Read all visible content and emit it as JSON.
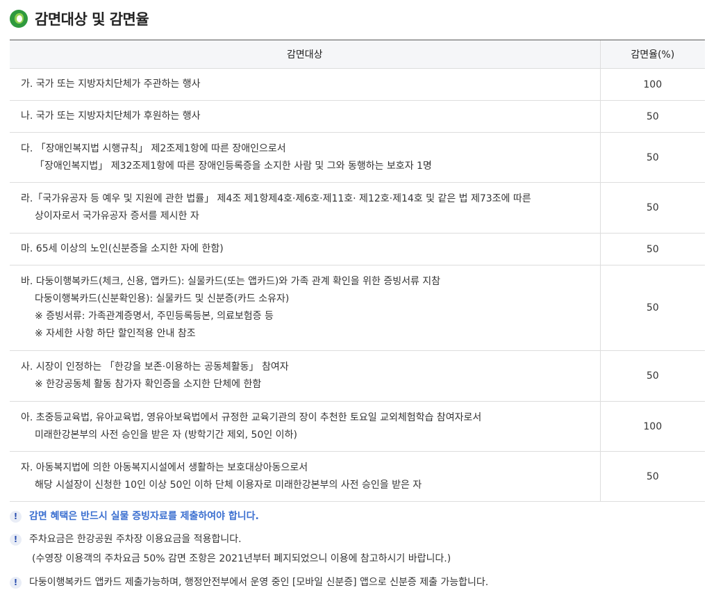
{
  "page_title": "감면대상 및 감면율",
  "table": {
    "headers": {
      "target": "감면대상",
      "rate": "감면율(%)"
    },
    "rows": [
      {
        "lines": [
          "가. 국가 또는 지방자치단체가 주관하는 행사"
        ],
        "rate": "100"
      },
      {
        "lines": [
          "나. 국가 또는 지방자치단체가 후원하는 행사"
        ],
        "rate": "50"
      },
      {
        "lines": [
          "다. 「장애인복지법 시행규칙」 제2조제1항에 따른 장애인으로서",
          "「장애인복지법」 제32조제1항에 따른 장애인등록증을 소지한 사람 및 그와 동행하는 보호자 1명"
        ],
        "rate": "50"
      },
      {
        "lines": [
          "라.「국가유공자 등 예우 및 지원에 관한 법률」 제4조 제1항제4호·제6호·제11호· 제12호·제14호 및 같은 법 제73조에 따른",
          "상이자로서 국가유공자 증서를 제시한 자"
        ],
        "rate": "50"
      },
      {
        "lines": [
          "마. 65세 이상의 노인(신분증을 소지한 자에 한함)"
        ],
        "rate": "50"
      },
      {
        "lines": [
          "바. 다둥이행복카드(체크, 신용, 앱카드): 실물카드(또는 앱카드)와 가족 관계 확인을 위한 증빙서류 지참",
          "다둥이행복카드(신분확인용): 실물카드 및 신분증(카드 소유자)",
          "※ 증빙서류: 가족관계증명서, 주민등록등본, 의료보험증 등",
          "※ 자세한 사항 하단 할인적용 안내 참조"
        ],
        "rate": "50"
      },
      {
        "lines": [
          "사. 시장이 인정하는 「한강을 보존·이용하는 공동체활동」 참여자",
          "※ 한강공동체 활동 참가자 확인증을 소지한 단체에 한함"
        ],
        "rate": "50"
      },
      {
        "lines": [
          "아. 초중등교육법, 유아교육법, 영유아보육법에서 규정한 교육기관의 장이 추천한 토요일 교외체험학습 참여자로서",
          "미래한강본부의 사전 승인을 받은 자 (방학기간 제외, 50인 이하)"
        ],
        "rate": "100"
      },
      {
        "lines": [
          "자. 아동복지법에 의한 아동복지시설에서 생활하는 보호대상아동으로서",
          "해당 시설장이 신청한 10인 이상 50인 이하 단체 이용자로 미래한강본부의 사전 승인을 받은 자"
        ],
        "rate": "50"
      }
    ]
  },
  "notes": {
    "icon": "!",
    "n1": "감면 혜택은 반드시 실물 증빙자료를 제출하여야 합니다.",
    "n2": "주차요금은 한강공원 주차장 이용요금을 적용합니다.",
    "n2_sub": "(수영장 이용객의 주차요금 50% 감면 조항은 2021년부터 폐지되었으니 이용에 참고하시기 바랍니다.)",
    "n3": "다둥이행복카드 앱카드 제출가능하며, 행정안전부에서 운영 중인 [모바일 신분증] 앱으로 신분증 제출 가능합니다."
  },
  "colors": {
    "accent": "#3b6fd0",
    "logo_green": "#2f9a3e",
    "header_bg": "#f5f6f8"
  }
}
